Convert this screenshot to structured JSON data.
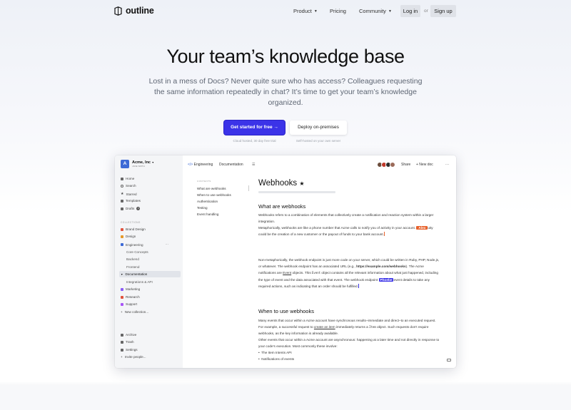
{
  "nav": {
    "brand": "outline",
    "links": [
      {
        "label": "Product",
        "has_menu": true
      },
      {
        "label": "Pricing",
        "has_menu": false
      },
      {
        "label": "Community",
        "has_menu": true
      }
    ],
    "login": "Log in",
    "or": "or",
    "signup": "Sign up"
  },
  "hero": {
    "title": "Your team’s knowledge base",
    "subtitle": "Lost in a mess of Docs? Never quite sure who has access? Colleagues requesting the same information repeatedly in chat? It’s time to get your team’s knowledge organized.",
    "cta_primary": "Get started for free →",
    "cta_secondary": "Deploy on-premises",
    "note_primary": "Cloud hosted, 30 day free trial",
    "note_secondary": "Self-hosted on your own server"
  },
  "app": {
    "team": {
      "initial": "A",
      "name": "Acme, Inc",
      "user": "JANE SMITH"
    },
    "sidebar": {
      "nav": [
        "Home",
        "Search",
        "Starred",
        "Templates",
        "Drafts"
      ],
      "drafts_count": "3",
      "collections_header": "COLLECTIONS",
      "collections": [
        {
          "label": "Brand Design",
          "color": "#e0533d"
        },
        {
          "label": "Design",
          "color": "#e59a2a"
        },
        {
          "label": "Engineering",
          "color": "#3d6ad6"
        }
      ],
      "engineering_children": [
        "Core Concepts",
        "Backend",
        "Frontend"
      ],
      "active_doc": "Documentation",
      "active_children": [
        "Integrations & API"
      ],
      "more_collections": [
        {
          "label": "Marketing",
          "color": "#8b5cf6"
        },
        {
          "label": "Research",
          "color": "#e0533d"
        },
        {
          "label": "Support",
          "color": "#a855f7"
        }
      ],
      "new_collection": "New collection...",
      "footer": [
        "Archive",
        "Trash",
        "Settings",
        "Invite people..."
      ]
    },
    "topbar": {
      "breadcrumb_collection": "Engineering",
      "breadcrumb_doc": "Documentation",
      "share": "Share",
      "new_doc": "+ New doc",
      "more": "···"
    },
    "toc": {
      "header": "CONTENTS",
      "items": [
        "What are webhooks",
        "When to use webhooks",
        "Authentication",
        "Testing",
        "Event handling"
      ]
    },
    "doc": {
      "title": "Webhooks",
      "h2_1": "What are webhooks",
      "p1": "Webhooks refers to a combination of elements that collectively create a notification and reaction system within a larger integration.",
      "p2a": "Metaphorically, webhooks are like a phone number that Acme calls to notify you of activity in your account.",
      "p2_tag": "Alex",
      "p2b": "uity could be the creation of a new customer or the payout of funds to your bank account.",
      "p3a": "Non-metaphorically, the webhook endpoint is just more code on your server, which could be written in Ruby, PHP, Node.js, or whatever. The webhook endpoint has an associated URL (e.g.,",
      "p3_url": "https://example.com/webhooks",
      "p3b": "). The Acme notifications are",
      "p3_event": "Event",
      "p3c": "objects. This",
      "p3_code": "Event",
      "p3d": "object contains all the relevant information about what just happened, including the type of event and the data associated with that event. The webhook endpoint",
      "p3_tag": "Phoebe",
      "p3e": "event details to take any required actions, such as indicating that an order should be fulfilled.",
      "h2_2": "When to use webhooks",
      "p4a": "Many events that occur within a Acme account have synchronous results–immediate and direct–to an executed request. For example, a successful request to",
      "p4_link": "create an item",
      "p4b": "immediately returns a",
      "p4_code": "Item",
      "p4c": "object. Such requests don’t require webhooks, as the key information is already available.",
      "p5": "Other events that occur within a Acme account are asynchronous: happening at a later time and not directly in response to your code’s execution. Most commonly these involve:",
      "bullets": [
        "The Item Intents API",
        "Notifications of events"
      ]
    }
  }
}
